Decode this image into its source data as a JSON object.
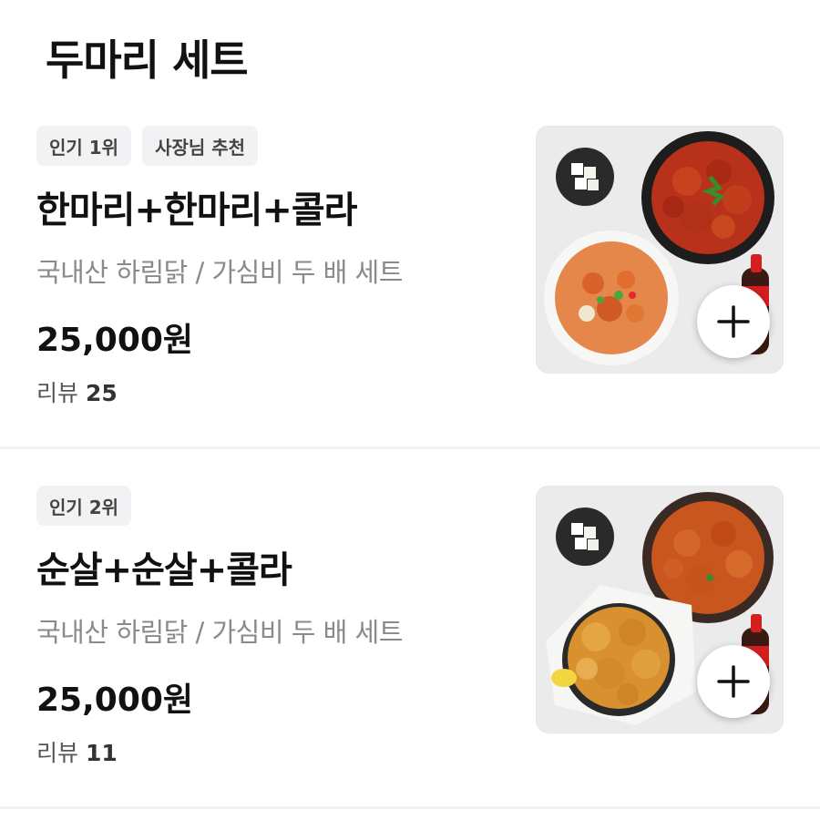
{
  "section": {
    "title": "두마리 세트"
  },
  "items": [
    {
      "tags": [
        "인기 1위",
        "사장님 추천"
      ],
      "name": "한마리+한마리+콜라",
      "description": "국내산 하림닭 / 가심비 두 배 세트",
      "price": "25,000원",
      "review_label": "리뷰",
      "review_count": "25",
      "add_icon": "plus-icon"
    },
    {
      "tags": [
        "인기 2위"
      ],
      "name": "순살+순살+콜라",
      "description": "국내산 하림닭 / 가심비 두 배 세트",
      "price": "25,000원",
      "review_label": "리뷰",
      "review_count": "11",
      "add_icon": "plus-icon"
    }
  ],
  "colors": {
    "tag_bg": "#f2f2f4",
    "description": "#8a8a8a",
    "sauce_chicken": "#c23a1a",
    "fried_chicken": "#d9902f",
    "cola_red": "#d41f1f"
  }
}
